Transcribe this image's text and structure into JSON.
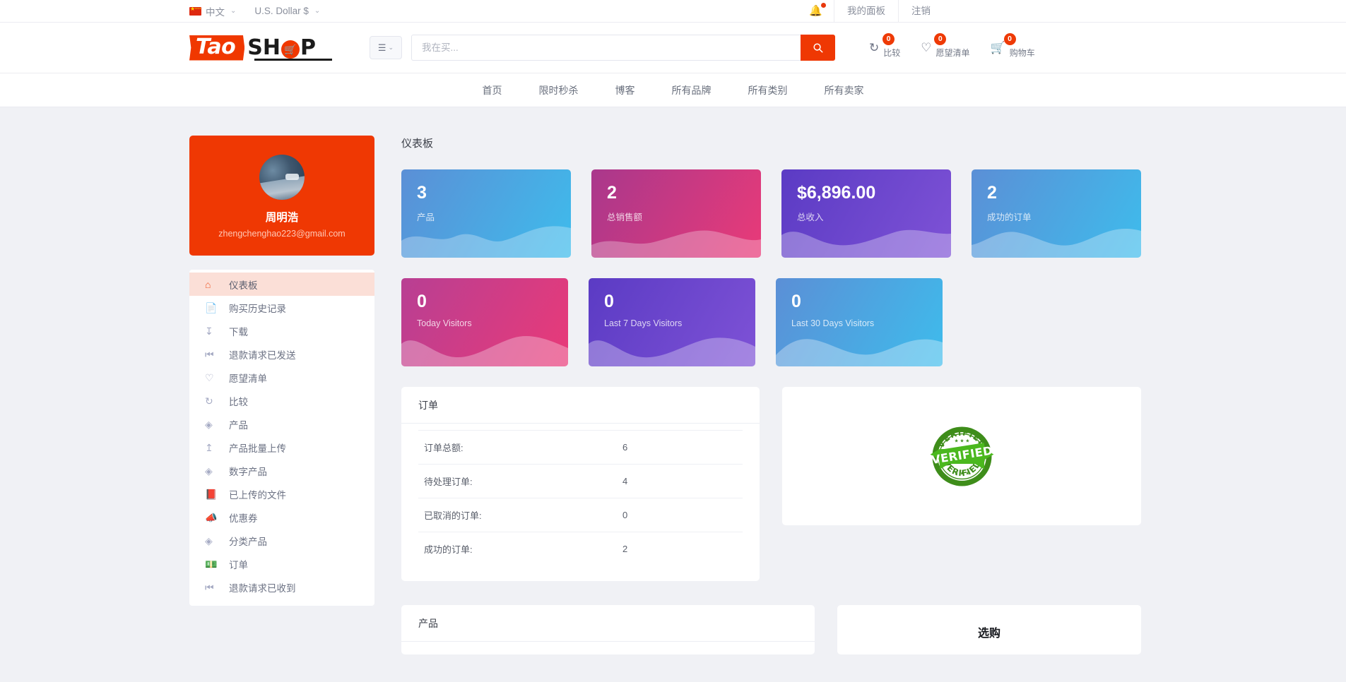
{
  "topbar": {
    "language": "中文",
    "currency": "U.S. Dollar $",
    "my_panel": "我的面板",
    "logout": "注销"
  },
  "header": {
    "logo": {
      "tao": "Tao",
      "sh": "SH",
      "p": "P",
      "cart_icon": "shopping-cart-icon"
    },
    "search": {
      "placeholder": "我在买...",
      "value": "",
      "button_icon": "search-icon"
    },
    "category_button": {
      "icon": "hamburger-icon",
      "caret": "chevron-down-icon"
    },
    "icons": [
      {
        "name": "compare",
        "glyph": "compare-icon",
        "count": "0",
        "label": "比较"
      },
      {
        "name": "wishlist",
        "glyph": "heart-icon",
        "count": "0",
        "label": "愿望清单"
      },
      {
        "name": "cart",
        "glyph": "cart-icon",
        "count": "0",
        "label": "购物车"
      }
    ]
  },
  "nav": {
    "items": [
      {
        "label": "首页"
      },
      {
        "label": "限时秒杀"
      },
      {
        "label": "博客"
      },
      {
        "label": "所有品牌"
      },
      {
        "label": "所有类别"
      },
      {
        "label": "所有卖家"
      }
    ]
  },
  "sidebar": {
    "profile": {
      "name": "周明浩",
      "email": "zhengchenghao223@gmail.com"
    },
    "items": [
      {
        "label": "仪表板",
        "icon": "home-icon",
        "active": true
      },
      {
        "label": "购买历史记录",
        "icon": "file-icon",
        "active": false
      },
      {
        "label": "下载",
        "icon": "download-icon",
        "active": false
      },
      {
        "label": "退款请求已发送",
        "icon": "rewind-icon",
        "active": false
      },
      {
        "label": "愿望清单",
        "icon": "heart-icon",
        "active": false
      },
      {
        "label": "比较",
        "icon": "compare-icon",
        "active": false
      },
      {
        "label": "产品",
        "icon": "diamond-icon",
        "active": false
      },
      {
        "label": "产品批量上传",
        "icon": "upload-icon",
        "active": false
      },
      {
        "label": "数字产品",
        "icon": "diamond-icon",
        "active": false
      },
      {
        "label": "已上传的文件",
        "icon": "book-icon",
        "active": false
      },
      {
        "label": "优惠券",
        "icon": "megaphone-icon",
        "active": false
      },
      {
        "label": "分类产品",
        "icon": "diamond-icon",
        "active": false
      },
      {
        "label": "订单",
        "icon": "banknote-icon",
        "active": false
      },
      {
        "label": "退款请求已收到",
        "icon": "rewind-icon",
        "active": false
      }
    ]
  },
  "main": {
    "title": "仪表板",
    "stats_row1": [
      {
        "value": "3",
        "caption": "产品",
        "color_from": "#5b8fd6",
        "color_to": "#3ebcec"
      },
      {
        "value": "2",
        "caption": "总销售额",
        "color_from": "#b83f93",
        "color_to": "#e93a78"
      },
      {
        "value": "$6,896.00",
        "caption": "总收入",
        "color_from": "#5b3bc4",
        "color_to": "#7b4fd4"
      },
      {
        "value": "2",
        "caption": "成功的订单",
        "color_from": "#5b8fd6",
        "color_to": "#3ebcec"
      }
    ],
    "stats_row2": [
      {
        "value": "0",
        "caption": "Today Visitors",
        "color_from": "#b83f93",
        "color_to": "#e93a78"
      },
      {
        "value": "0",
        "caption": "Last 7 Days Visitors",
        "color_from": "#5b3bc4",
        "color_to": "#7b4fd4"
      },
      {
        "value": "0",
        "caption": "Last 30 Days Visitors",
        "color_from": "#5b8fd6",
        "color_to": "#3ebcec"
      }
    ],
    "orders_panel": {
      "title": "订单",
      "rows": [
        {
          "label": "订单总额:",
          "value": "6"
        },
        {
          "label": "待处理订单:",
          "value": "4"
        },
        {
          "label": "已取消的订单:",
          "value": "0"
        },
        {
          "label": "成功的订单:",
          "value": "2"
        }
      ]
    },
    "verified_panel": {
      "badge_icon": "verified-stamp-icon",
      "badge_text": "VERIFIED",
      "badge_color": "#3aa81c"
    },
    "products_panel": {
      "title": "产品"
    },
    "shop_panel": {
      "title": "选购"
    }
  }
}
